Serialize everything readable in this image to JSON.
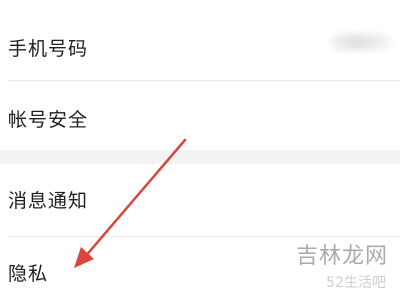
{
  "settings": {
    "group1": {
      "phone_label": "手机号码",
      "security_label": "帐号安全"
    },
    "group2": {
      "notify_label": "消息通知",
      "privacy_label": "隐私"
    }
  },
  "watermark": {
    "main": "吉林龙网",
    "sub": "52生活吧"
  },
  "annotation": {
    "arrow_color": "#d9453f"
  },
  "colors": {
    "text": "#202020",
    "divider": "#ececec",
    "section_gap": "#f3f3f3",
    "background": "#ffffff"
  }
}
